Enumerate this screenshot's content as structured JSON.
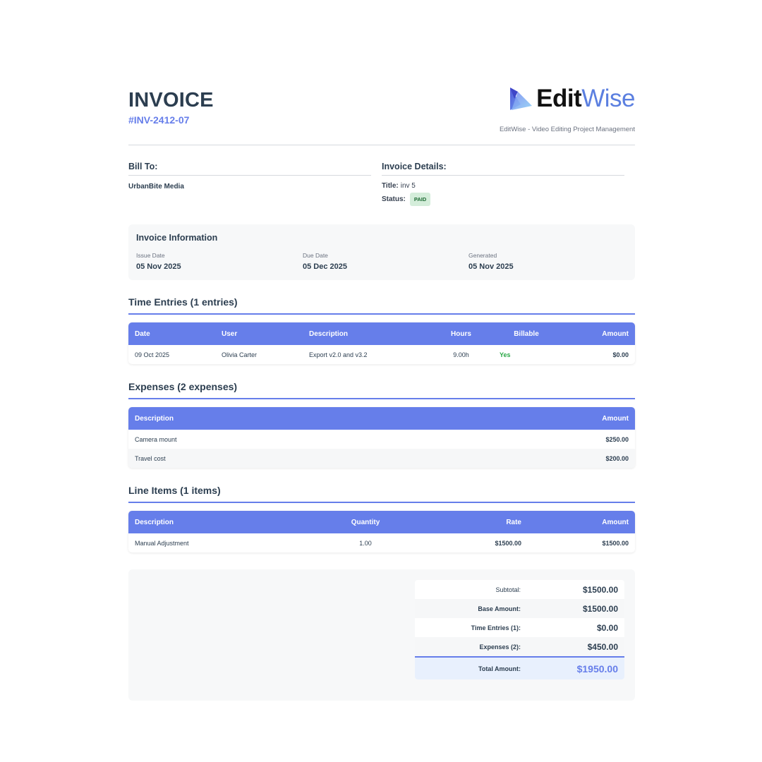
{
  "header": {
    "title": "INVOICE",
    "number": "#INV-2412-07",
    "logo_edit": "Edit",
    "logo_wise": "Wise",
    "tagline": "EditWise - Video Editing Project Management"
  },
  "bill_to": {
    "heading": "Bill To:",
    "client": "UrbanBite Media"
  },
  "details": {
    "heading": "Invoice Details:",
    "title_label": "Title:",
    "title_value": "inv 5",
    "status_label": "Status:",
    "status_value": "PAID"
  },
  "info": {
    "heading": "Invoice Information",
    "issue_label": "Issue Date",
    "issue_value": "05 Nov 2025",
    "due_label": "Due Date",
    "due_value": "05 Dec 2025",
    "generated_label": "Generated",
    "generated_value": "05 Nov 2025"
  },
  "time_entries": {
    "heading": "Time Entries (1 entries)",
    "columns": [
      "Date",
      "User",
      "Description",
      "Hours",
      "Billable",
      "Amount"
    ],
    "rows": [
      {
        "date": "09 Oct 2025",
        "user": "Olivia Carter",
        "description": "Export v2.0 and v3.2",
        "hours": "9.00h",
        "billable": "Yes",
        "amount": "$0.00"
      }
    ]
  },
  "expenses": {
    "heading": "Expenses (2 expenses)",
    "columns": [
      "Description",
      "Amount"
    ],
    "rows": [
      {
        "description": "Camera mount",
        "amount": "$250.00"
      },
      {
        "description": "Travel cost",
        "amount": "$200.00"
      }
    ]
  },
  "line_items": {
    "heading": "Line Items (1 items)",
    "columns": [
      "Description",
      "Quantity",
      "Rate",
      "Amount"
    ],
    "rows": [
      {
        "description": "Manual Adjustment",
        "quantity": "1.00",
        "rate": "$1500.00",
        "amount": "$1500.00"
      }
    ]
  },
  "totals": {
    "subtotal_label": "Subtotal:",
    "subtotal_value": "$1500.00",
    "base_label": "Base Amount:",
    "base_value": "$1500.00",
    "time_label": "Time Entries (1):",
    "time_value": "$0.00",
    "expenses_label": "Expenses (2):",
    "expenses_value": "$450.00",
    "total_label": "Total Amount:",
    "total_value": "$1950.00"
  },
  "colors": {
    "accent": "#667eea",
    "heading": "#2c3e50",
    "paid_badge_bg": "#d4edda",
    "billable_yes": "#28a745"
  }
}
